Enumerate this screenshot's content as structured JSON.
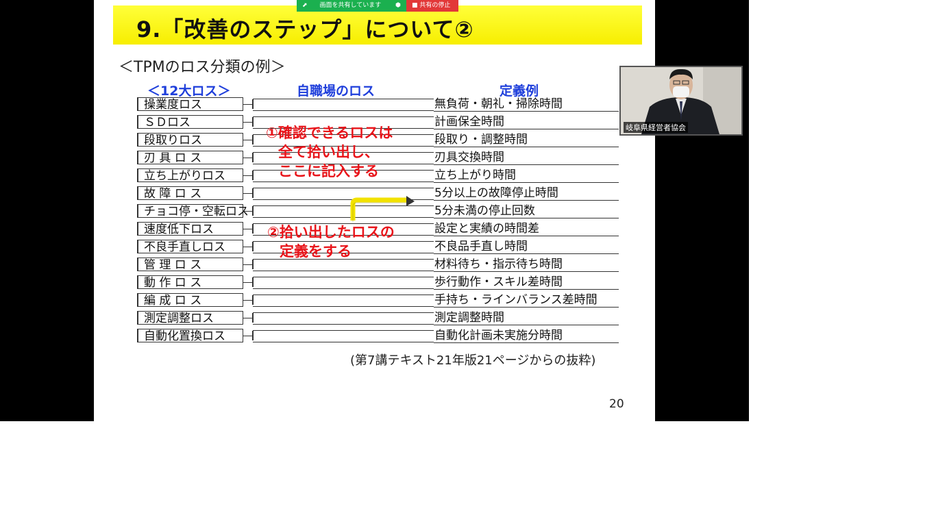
{
  "share_bar": {
    "sharing_label": "画面を共有しています",
    "stop_label": "共有の停止"
  },
  "slide": {
    "title": "9.「改善のステップ」について②",
    "subtitle": "＜TPMのロス分類の例＞",
    "col_heads": [
      "＜12大ロス＞",
      "自職場のロス",
      "定義例"
    ],
    "rows": [
      {
        "loss": "操業度ロス",
        "definition": "無負荷・朝礼・掃除時間"
      },
      {
        "loss": "ＳＤロス",
        "definition": "計画保全時間"
      },
      {
        "loss": "段取りロス",
        "definition": "段取り・調整時間"
      },
      {
        "loss": "刃 具 ロ ス",
        "definition": "刃具交換時間"
      },
      {
        "loss": "立ち上がりロス",
        "definition": "立ち上がり時間"
      },
      {
        "loss": "故 障 ロ ス",
        "definition": "5分以上の故障停止時間"
      },
      {
        "loss": "チョコ停・空転ロス",
        "definition": "5分未満の停止回数"
      },
      {
        "loss": "速度低下ロス",
        "definition": "設定と実績の時間差"
      },
      {
        "loss": "不良手直しロス",
        "definition": "不良品手直し時間"
      },
      {
        "loss": "管 理 ロ ス",
        "definition": "材料待ち・指示待ち時間"
      },
      {
        "loss": "動 作 ロ ス",
        "definition": "歩行動作・スキル差時間"
      },
      {
        "loss": "編 成 ロ ス",
        "definition": "手持ち・ラインバランス差時間"
      },
      {
        "loss": "測定調整ロス",
        "definition": "測定調整時間"
      },
      {
        "loss": "自動化置換ロス",
        "definition": "自動化計画未実施分時間"
      }
    ],
    "note1": [
      "①確認できるロスは",
      "全て拾い出し、",
      "ここに記入する"
    ],
    "note2": [
      "②拾い出したロスの",
      "定義をする"
    ],
    "source": "(第7講テキスト21年版21ページからの抜粋)",
    "page_number": "20"
  },
  "camera": {
    "participant_name": "岐阜県経営者協会"
  },
  "colors": {
    "title_band": "#f7ee00",
    "heading_blue": "#1f3fdb",
    "note_red": "#e8141a",
    "arrow_yellow": "#f2e200",
    "share_green": "#1bb04f",
    "share_red": "#e23838"
  }
}
